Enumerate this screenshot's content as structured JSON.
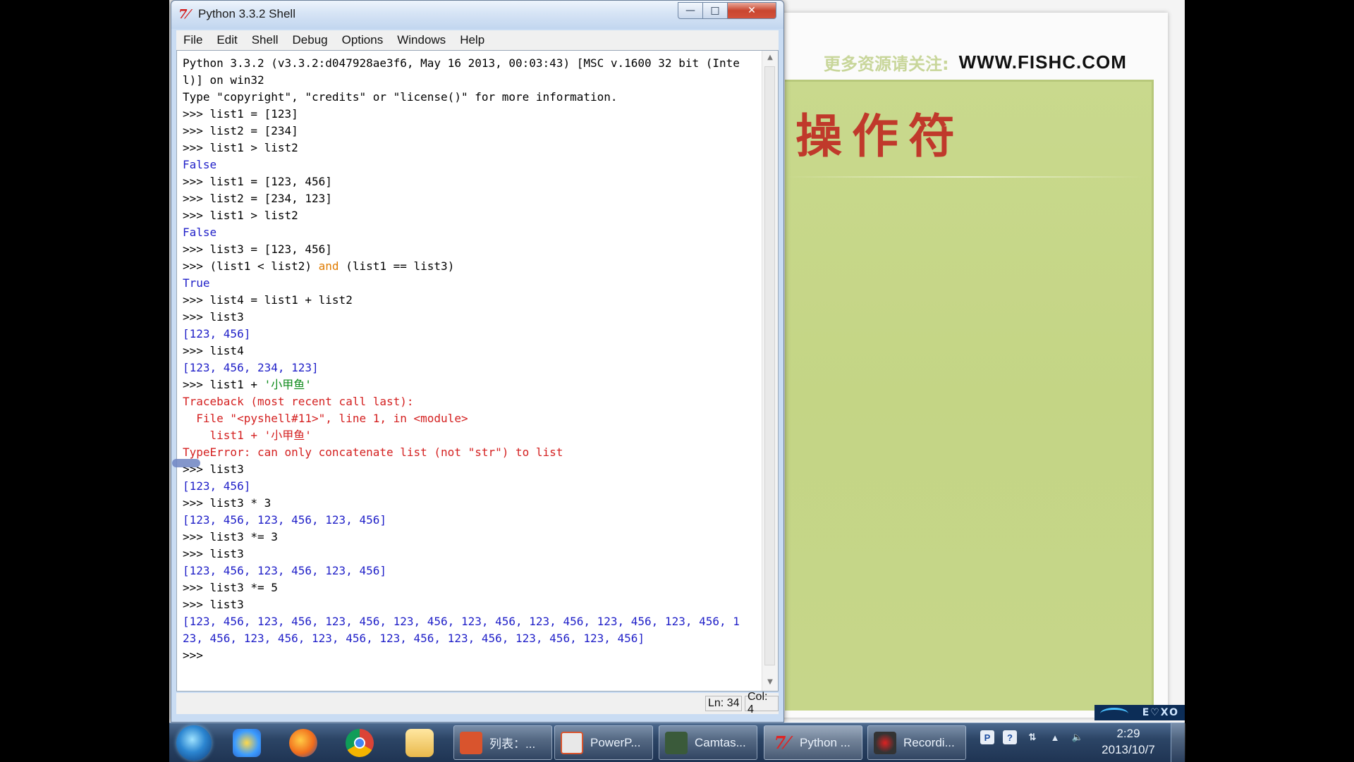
{
  "window": {
    "title": "Python 3.3.2 Shell",
    "app_icon_glyph": "7⁄",
    "menu": [
      "File",
      "Edit",
      "Shell",
      "Debug",
      "Options",
      "Windows",
      "Help"
    ],
    "caption_buttons": {
      "minimize": "—",
      "maximize": "□",
      "close": "✕"
    }
  },
  "shell": {
    "lines": [
      {
        "t": "Python 3.3.2 (v3.3.2:d047928ae3f6, May 16 2013, 00:03:43) [MSC v.1600 32 bit (Inte",
        "c": "plain"
      },
      {
        "t": "l)] on win32",
        "c": "plain"
      },
      {
        "t": "Type \"copyright\", \"credits\" or \"license()\" for more information.",
        "c": "plain"
      },
      {
        "t": ">>> list1 = [123]",
        "c": "plain"
      },
      {
        "t": ">>> list2 = [234]",
        "c": "plain"
      },
      {
        "t": ">>> list1 > list2",
        "c": "plain"
      },
      {
        "t": "False",
        "c": "out"
      },
      {
        "t": ">>> list1 = [123, 456]",
        "c": "plain"
      },
      {
        "t": ">>> list2 = [234, 123]",
        "c": "plain"
      },
      {
        "t": ">>> list1 > list2",
        "c": "plain"
      },
      {
        "t": "False",
        "c": "out"
      },
      {
        "t": ">>> list3 = [123, 456]",
        "c": "plain"
      },
      {
        "pre": ">>> (list1 < list2) ",
        "kw": "and",
        "post": " (list1 == list3)",
        "c": "kwline"
      },
      {
        "t": "True",
        "c": "out"
      },
      {
        "t": ">>> list4 = list1 + list2",
        "c": "plain"
      },
      {
        "t": ">>> list3",
        "c": "plain"
      },
      {
        "t": "[123, 456]",
        "c": "out"
      },
      {
        "t": ">>> list4",
        "c": "plain"
      },
      {
        "t": "[123, 456, 234, 123]",
        "c": "out"
      },
      {
        "pre": ">>> list1 + ",
        "str": "'小甲鱼'",
        "c": "strline"
      },
      {
        "t": "Traceback (most recent call last):",
        "c": "err"
      },
      {
        "t": "  File \"<pyshell#11>\", line 1, in <module>",
        "c": "err"
      },
      {
        "t": "    list1 + '小甲鱼'",
        "c": "err"
      },
      {
        "t": "TypeError: can only concatenate list (not \"str\") to list",
        "c": "err"
      },
      {
        "t": ">>> list3",
        "c": "plain"
      },
      {
        "t": "[123, 456]",
        "c": "out"
      },
      {
        "t": ">>> list3 * 3",
        "c": "plain"
      },
      {
        "t": "[123, 456, 123, 456, 123, 456]",
        "c": "out"
      },
      {
        "t": ">>> list3 *= 3",
        "c": "plain"
      },
      {
        "t": ">>> list3",
        "c": "plain"
      },
      {
        "t": "[123, 456, 123, 456, 123, 456]",
        "c": "out"
      },
      {
        "t": ">>> list3 *= 5",
        "c": "plain"
      },
      {
        "t": ">>> list3",
        "c": "plain"
      },
      {
        "t": "[123, 456, 123, 456, 123, 456, 123, 456, 123, 456, 123, 456, 123, 456, 123, 456, 1",
        "c": "out"
      },
      {
        "t": "23, 456, 123, 456, 123, 456, 123, 456, 123, 456, 123, 456, 123, 456]",
        "c": "out"
      },
      {
        "t": ">>> ",
        "c": "plain"
      }
    ]
  },
  "status": {
    "ln": "Ln: 34",
    "col": "Col: 4"
  },
  "slide": {
    "header_cn": "更多资源请关注:",
    "header_url": "WWW.FISHC.COM",
    "title": "操作符",
    "badge": "E♡XO"
  },
  "taskbar": {
    "tasks": [
      {
        "id": "ppt1",
        "label": "列表：..."
      },
      {
        "id": "ppt2",
        "label": "PowerP..."
      },
      {
        "id": "camtasia",
        "label": "Camtas..."
      },
      {
        "id": "python",
        "label": "Python ..."
      },
      {
        "id": "rec",
        "label": "Recordi..."
      }
    ],
    "clock_time": "2:29",
    "clock_date": "2013/10/7"
  },
  "colors": {
    "output": "#1f1fc8",
    "error": "#d42020",
    "string": "#0d8a1a",
    "keyword": "#e07b00",
    "slide_title": "#c0392b",
    "slide_green": "#c6d68a"
  }
}
